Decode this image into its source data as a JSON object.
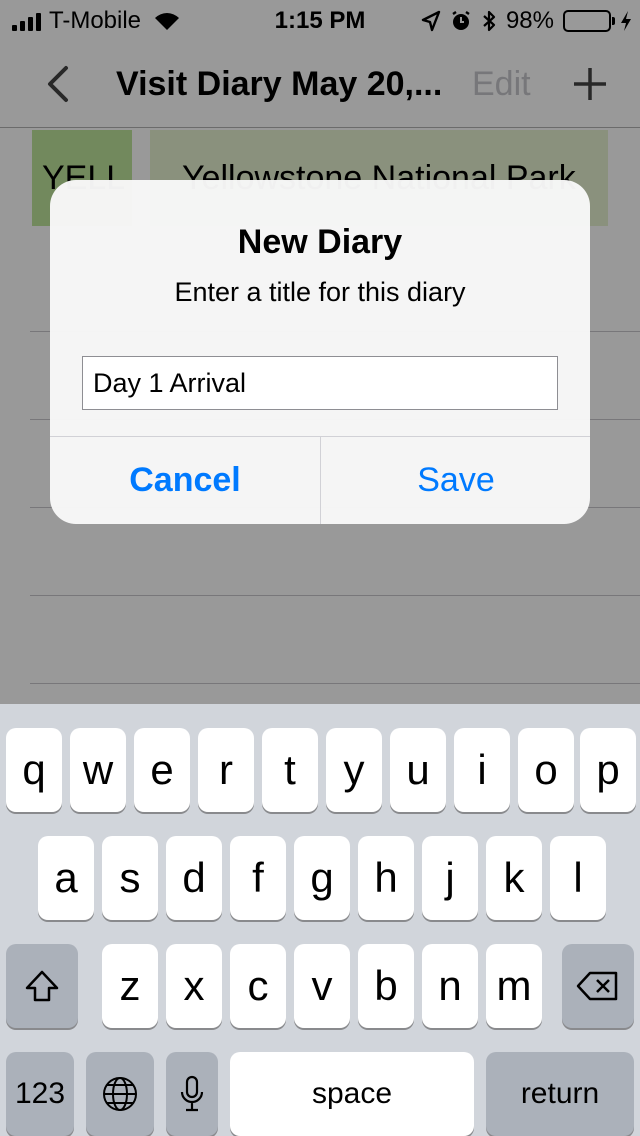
{
  "status_bar": {
    "carrier": "T-Mobile",
    "time": "1:15 PM",
    "battery": "98%",
    "battery_level": 0.98
  },
  "nav": {
    "title": "Visit Diary May 20,...",
    "edit_label": "Edit"
  },
  "list": {
    "row_code": "YELL",
    "row_name": "Yellowstone National Park"
  },
  "alert": {
    "title": "New Diary",
    "message": "Enter a title for this diary",
    "field_value": "Day 1 Arrival",
    "cancel_label": "Cancel",
    "save_label": "Save"
  },
  "keyboard": {
    "row1": [
      "q",
      "w",
      "e",
      "r",
      "t",
      "y",
      "u",
      "i",
      "o",
      "p"
    ],
    "row2": [
      "a",
      "s",
      "d",
      "f",
      "g",
      "h",
      "j",
      "k",
      "l"
    ],
    "row3": [
      "z",
      "x",
      "c",
      "v",
      "b",
      "n",
      "m"
    ],
    "numbers_label": "123",
    "space_label": "space",
    "return_label": "return"
  },
  "colors": {
    "accent": "#007aff",
    "battery_green": "#4cd964",
    "keyboard_bg": "#d1d5db"
  }
}
